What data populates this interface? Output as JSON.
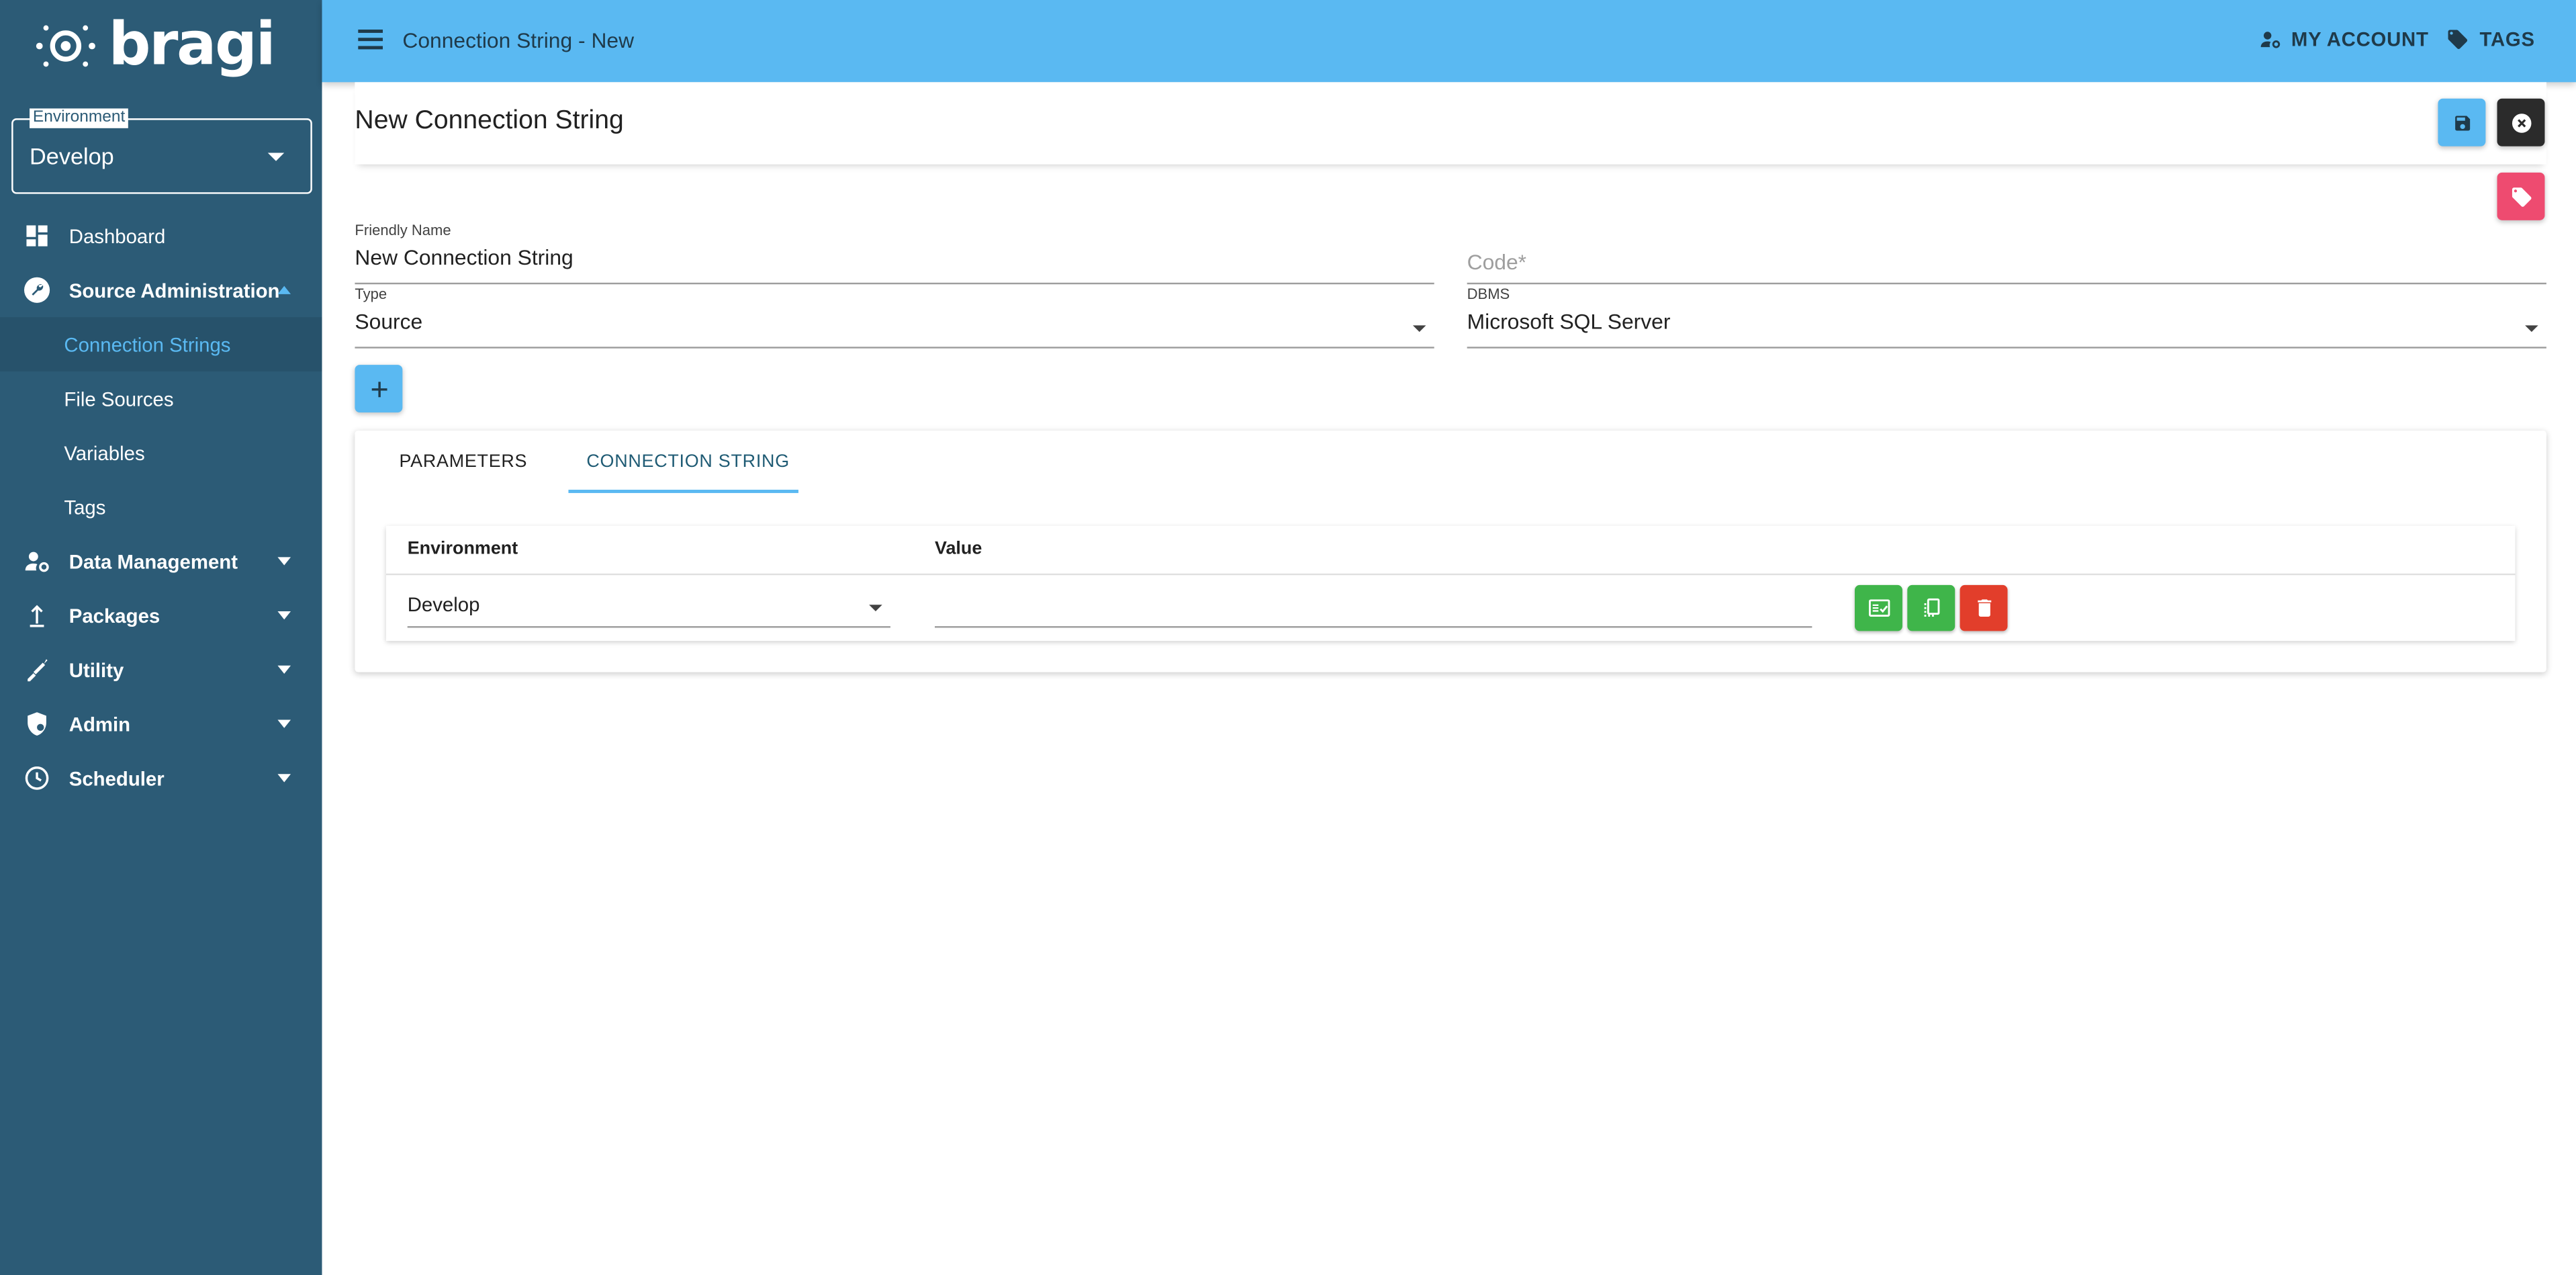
{
  "app": {
    "logo_text": "bragi"
  },
  "sidebar": {
    "environment": {
      "label": "Environment",
      "value": "Develop"
    },
    "items": [
      {
        "label": "Dashboard",
        "icon": "dashboard-icon"
      },
      {
        "label": "Source Administration",
        "icon": "wrench-icon",
        "expanded": true,
        "children": [
          {
            "label": "Connection Strings",
            "active": true
          },
          {
            "label": "File Sources"
          },
          {
            "label": "Variables"
          },
          {
            "label": "Tags"
          }
        ]
      },
      {
        "label": "Data Management",
        "icon": "user-gear-icon"
      },
      {
        "label": "Packages",
        "icon": "upload-arrow-icon"
      },
      {
        "label": "Utility",
        "icon": "tools-icon"
      },
      {
        "label": "Admin",
        "icon": "shield-icon"
      },
      {
        "label": "Scheduler",
        "icon": "clock-icon"
      }
    ]
  },
  "topbar": {
    "title": "Connection String - New",
    "my_account": "MY ACCOUNT",
    "tags": "TAGS"
  },
  "form": {
    "page_title": "New Connection String",
    "friendly_name": {
      "label": "Friendly Name",
      "value": "New Connection String"
    },
    "code": {
      "placeholder": "Code*"
    },
    "type": {
      "label": "Type",
      "value": "Source"
    },
    "dbms": {
      "label": "DBMS",
      "value": "Microsoft SQL Server"
    }
  },
  "tabs": [
    {
      "label": "PARAMETERS",
      "active": false
    },
    {
      "label": "CONNECTION STRING",
      "active": true
    }
  ],
  "table": {
    "headers": {
      "environment": "Environment",
      "value": "Value"
    },
    "rows": [
      {
        "environment": "Develop",
        "value": ""
      }
    ]
  },
  "colors": {
    "sidebar_bg": "#2c5b76",
    "topbar_bg": "#5ab9f2",
    "accent": "#5ab9f2",
    "tag_button": "#ee4b70",
    "success": "#3fb54a",
    "danger": "#e23e2b"
  }
}
